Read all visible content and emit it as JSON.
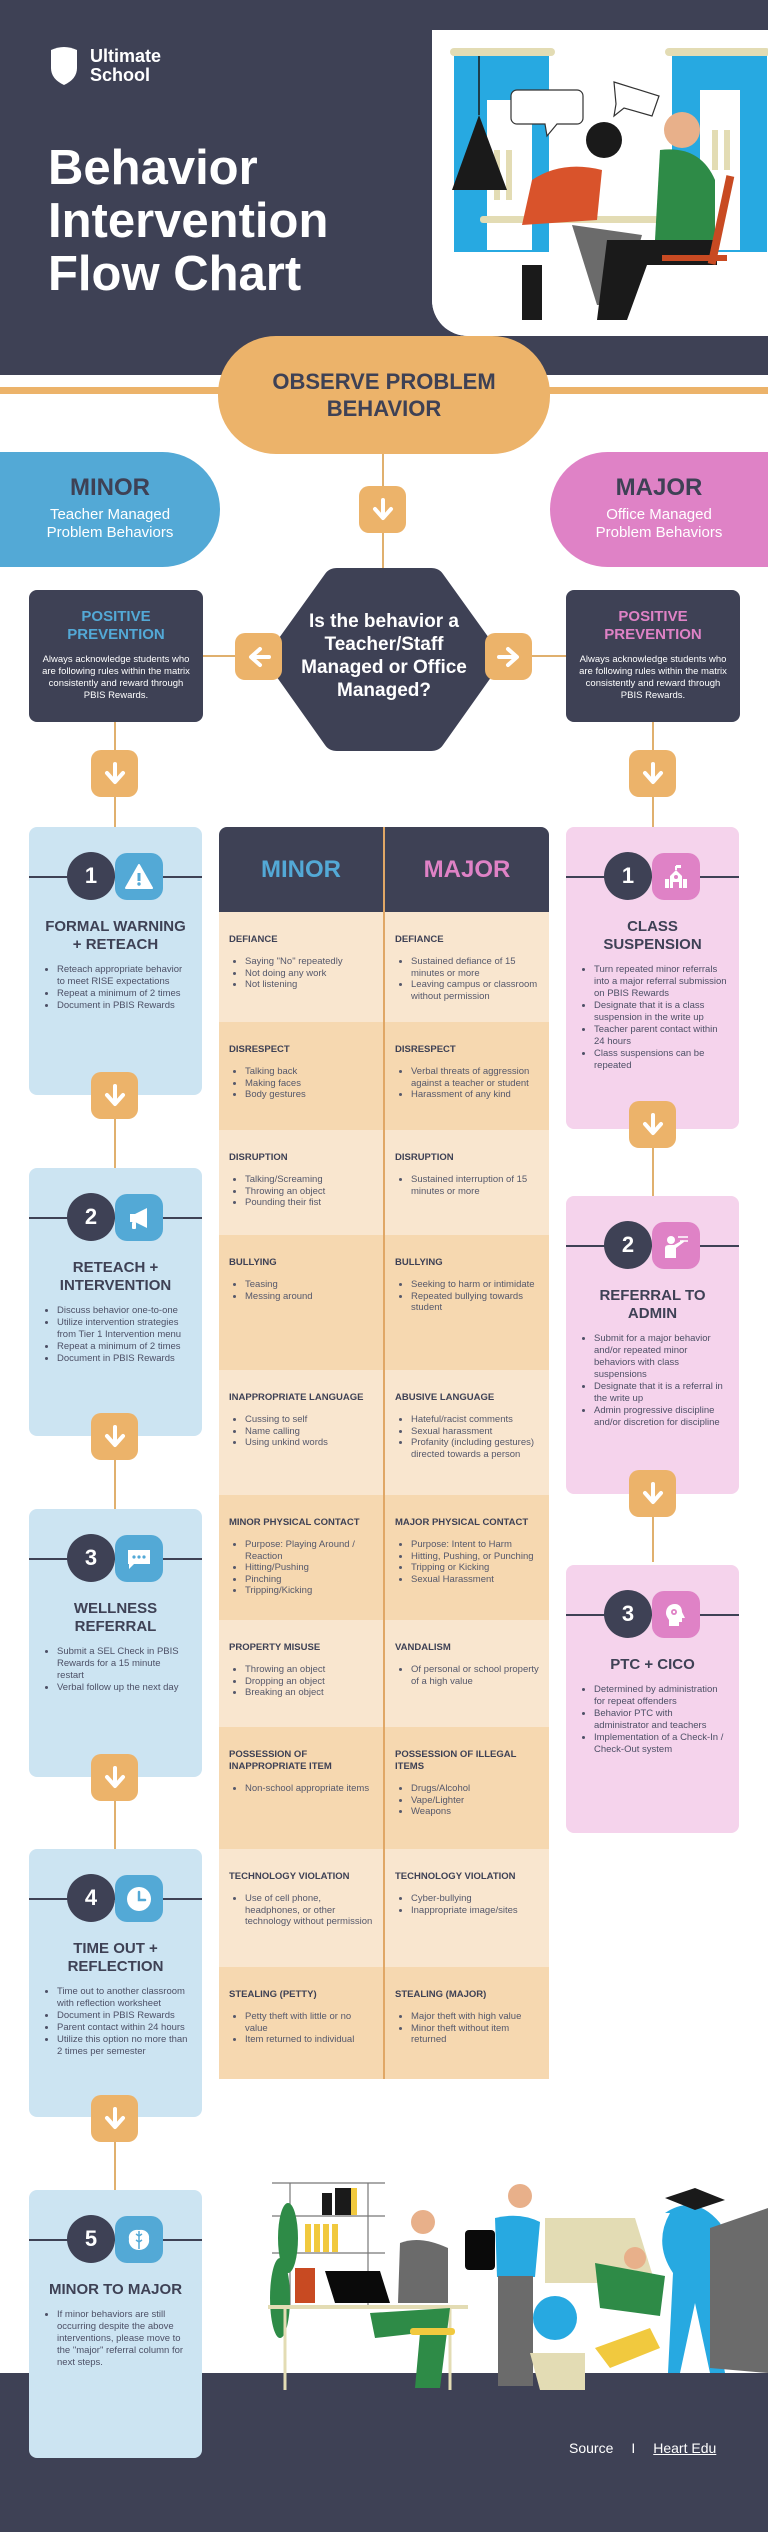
{
  "header": {
    "brand": "Ultimate\nSchool",
    "brand_line1": "Ultimate",
    "brand_line2": "School",
    "title_line1": "Behavior",
    "title_line2": "Intervention",
    "title_line3": "Flow Chart"
  },
  "observe": {
    "label": "OBSERVE PROBLEM BEHAVIOR"
  },
  "minor_pill": {
    "title": "MINOR",
    "subtitle_line1": "Teacher Managed",
    "subtitle_line2": "Problem Behaviors"
  },
  "major_pill": {
    "title": "MAJOR",
    "subtitle_line1": "Office Managed",
    "subtitle_line2": "Problem Behaviors"
  },
  "decision": {
    "question": "Is the behavior a Teacher/Staff Managed or Office Managed?"
  },
  "prevention": {
    "left": {
      "title": "POSITIVE PREVENTION",
      "text": "Always acknowledge students who are following rules within the matrix consistently and reward through PBIS Rewards."
    },
    "right": {
      "title": "POSITIVE PREVENTION",
      "text": "Always acknowledge students who are following rules within the matrix consistently and reward through PBIS Rewards."
    }
  },
  "colors": {
    "navy": "#3e4155",
    "orange": "#ecb36a",
    "blue": "#53a9d6",
    "pink": "#df82c6",
    "light_blue": "#cce4f2",
    "light_pink": "#f5d3ec"
  },
  "minor_steps": [
    {
      "number": "1",
      "icon": "warning-icon",
      "title": "FORMAL WARNING + RETEACH",
      "bullets": [
        "Reteach appropriate behavior to meet RISE expectations",
        "Repeat a minimum of 2 times",
        "Document in PBIS Rewards"
      ]
    },
    {
      "number": "2",
      "icon": "megaphone-icon",
      "title": "RETEACH + INTERVENTION",
      "bullets": [
        "Discuss behavior one-to-one",
        "Utilize intervention strategies from Tier 1 Intervention menu",
        "Repeat a minimum of 2 times",
        "Document in PBIS Rewards"
      ]
    },
    {
      "number": "3",
      "icon": "chat-bubble-icon",
      "title": "WELLNESS REFERRAL",
      "bullets": [
        "Submit a SEL Check in PBIS Rewards for a 15 minute restart",
        "Verbal follow up the next day"
      ]
    },
    {
      "number": "4",
      "icon": "clock-icon",
      "title": "TIME OUT + REFLECTION",
      "bullets": [
        "Time out to another classroom with reflection worksheet",
        "Document in PBIS Rewards",
        "Parent contact within 24 hours",
        "Utilize this option no more than 2 times per semester"
      ]
    },
    {
      "number": "5",
      "icon": "brain-icon",
      "title": "MINOR TO MAJOR",
      "bullets": [
        "If minor behaviors are still occurring despite the above interventions, please move to the \"major\" referral column for next steps."
      ]
    }
  ],
  "major_steps": [
    {
      "number": "1",
      "icon": "school-icon",
      "title": "CLASS SUSPENSION",
      "bullets": [
        "Turn repeated minor referrals into a major referral submission on PBIS Rewards",
        "Designate that it is a class suspension in the write up",
        "Teacher parent contact within 24 hours",
        "Class suspensions can be repeated"
      ]
    },
    {
      "number": "2",
      "icon": "teacher-icon",
      "title": "REFERRAL TO ADMIN",
      "bullets": [
        "Submit for a major behavior and/or repeated minor behaviors with class suspensions",
        "Designate that it is a referral in the write up",
        "Admin progressive discipline and/or discretion for discipline"
      ]
    },
    {
      "number": "3",
      "icon": "head-icon",
      "title": "PTC + CICO",
      "bullets": [
        "Determined by administration for repeat offenders",
        "Behavior PTC with administrator and teachers",
        "Implementation of a Check-In / Check-Out system"
      ]
    }
  ],
  "table": {
    "headers": [
      "MINOR",
      "MAJOR"
    ],
    "rows": [
      {
        "minor": {
          "title": "DEFIANCE",
          "items": [
            "Saying \"No\" repeatedly",
            "Not doing any work",
            "Not listening"
          ]
        },
        "major": {
          "title": "DEFIANCE",
          "items": [
            "Sustained defiance of 15 minutes or more",
            "Leaving campus or classroom without permission"
          ]
        }
      },
      {
        "minor": {
          "title": "DISRESPECT",
          "items": [
            "Talking back",
            "Making faces",
            "Body gestures"
          ]
        },
        "major": {
          "title": "DISRESPECT",
          "items": [
            "Verbal threats of aggression against a teacher or student",
            "Harassment of any kind"
          ]
        }
      },
      {
        "minor": {
          "title": "DISRUPTION",
          "items": [
            "Talking/Screaming",
            "Throwing an object",
            "Pounding their fist"
          ]
        },
        "major": {
          "title": "DISRUPTION",
          "items": [
            "Sustained interruption of 15 minutes or more"
          ]
        }
      },
      {
        "minor": {
          "title": "BULLYING",
          "items": [
            "Teasing",
            "Messing around"
          ]
        },
        "major": {
          "title": "BULLYING",
          "items": [
            "Seeking to harm or intimidate",
            "Repeated bullying towards student"
          ]
        }
      },
      {
        "minor": {
          "title": "INAPPROPRIATE LANGUAGE",
          "items": [
            "Cussing to self",
            "Name calling",
            "Using unkind words"
          ]
        },
        "major": {
          "title": "ABUSIVE LANGUAGE",
          "items": [
            "Hateful/racist comments",
            "Sexual harassment",
            "Profanity (including gestures) directed towards a person"
          ]
        }
      },
      {
        "minor": {
          "title": "MINOR PHYSICAL CONTACT",
          "items": [
            "Purpose: Playing Around / Reaction",
            "Hitting/Pushing",
            "Pinching",
            "Tripping/Kicking"
          ]
        },
        "major": {
          "title": "MAJOR PHYSICAL CONTACT",
          "items": [
            "Purpose: Intent to Harm",
            "Hitting, Pushing, or Punching",
            "Tripping or Kicking",
            "Sexual Harassment"
          ]
        }
      },
      {
        "minor": {
          "title": "PROPERTY MISUSE",
          "items": [
            "Throwing an object",
            "Dropping an object",
            "Breaking an object"
          ]
        },
        "major": {
          "title": "VANDALISM",
          "items": [
            "Of personal or school property of a high value"
          ]
        }
      },
      {
        "minor": {
          "title": "POSSESSION OF INAPPROPRIATE ITEM",
          "items": [
            "Non-school appropriate items"
          ]
        },
        "major": {
          "title": "POSSESSION OF ILLEGAL ITEMS",
          "items": [
            "Drugs/Alcohol",
            "Vape/Lighter",
            "Weapons"
          ]
        }
      },
      {
        "minor": {
          "title": "TECHNOLOGY VIOLATION",
          "items": [
            "Use of cell phone, headphones, or other technology without permission"
          ]
        },
        "major": {
          "title": "TECHNOLOGY VIOLATION",
          "items": [
            "Cyber-bullying",
            "Inappropriate image/sites"
          ]
        }
      },
      {
        "minor": {
          "title": "STEALING (PETTY)",
          "items": [
            "Petty theft with little or no value",
            "Item returned to individual"
          ]
        },
        "major": {
          "title": "STEALING (MAJOR)",
          "items": [
            "Major theft with high value",
            "Minor theft without item returned"
          ]
        }
      }
    ]
  },
  "footer": {
    "source_label": "Source",
    "separator": "I",
    "source_link": "Heart Edu"
  }
}
